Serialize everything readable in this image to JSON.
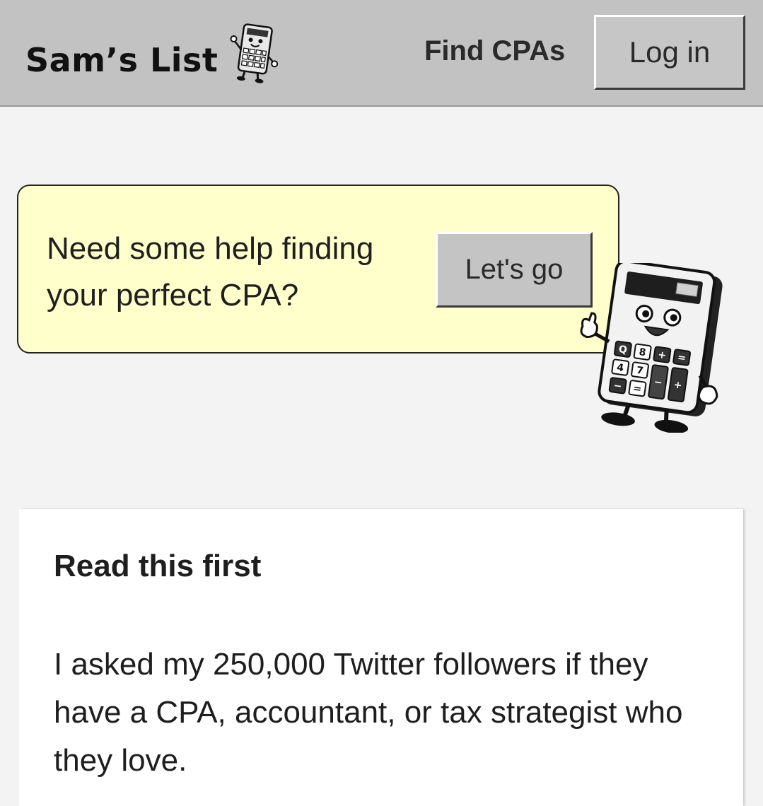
{
  "header": {
    "logo_text": "Sam’s List",
    "logo_icon": "calculator-mascot-icon",
    "nav": {
      "find_cpas": "Find CPAs"
    },
    "login_label": "Log in"
  },
  "promo": {
    "text": "Need some help finding your perfect CPA?",
    "button_label": "Let's go",
    "background_color": "#ffffcc",
    "mascot_icon": "calculator-mascot-icon",
    "mascot_keys": [
      "Q",
      "8",
      "+",
      "=",
      "4",
      "7",
      "−",
      "+",
      "−",
      "="
    ]
  },
  "card": {
    "title": "Read this first",
    "body": "I asked my 250,000 Twitter followers if they have a CPA, accountant, or tax strategist who they love."
  }
}
